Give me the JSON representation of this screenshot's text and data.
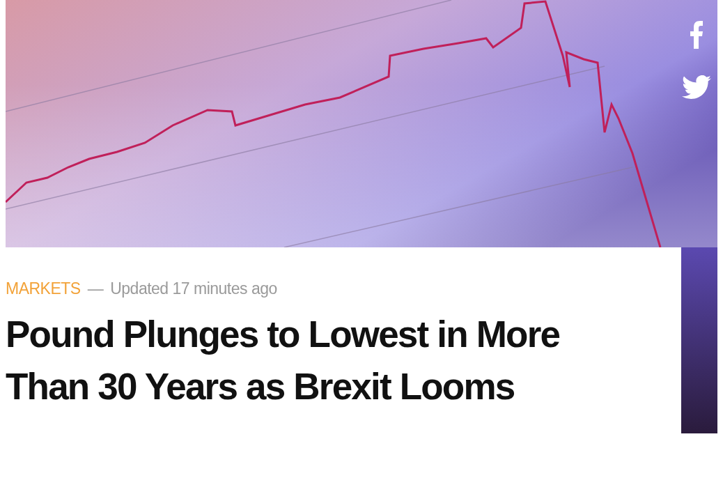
{
  "article": {
    "category": "MARKETS",
    "separator": "—",
    "updated": "Updated 17 minutes ago",
    "headline": "Pound Plunges to Lowest in More Than 30 Years as Brexit Looms"
  }
}
